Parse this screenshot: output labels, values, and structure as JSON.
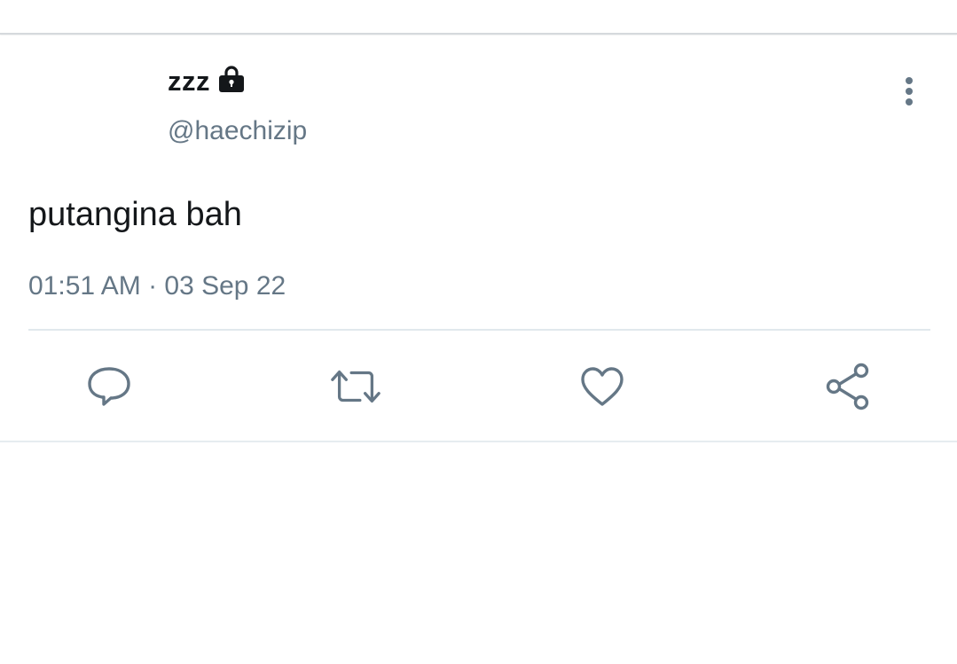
{
  "tweet": {
    "display_name": "zzz",
    "handle": "@haechizip",
    "text": "putangina bah",
    "timestamp": "01:51 AM · 03 Sep 22",
    "protected": true
  },
  "icons": {
    "lock": "lock-icon",
    "more": "more-vertical-icon",
    "reply": "reply-icon",
    "retweet": "retweet-icon",
    "like": "heart-icon",
    "share": "share-icon"
  },
  "colors": {
    "text_primary": "#14171a",
    "text_secondary": "#657786",
    "icon": "#657786",
    "divider": "#e1e8ed"
  }
}
